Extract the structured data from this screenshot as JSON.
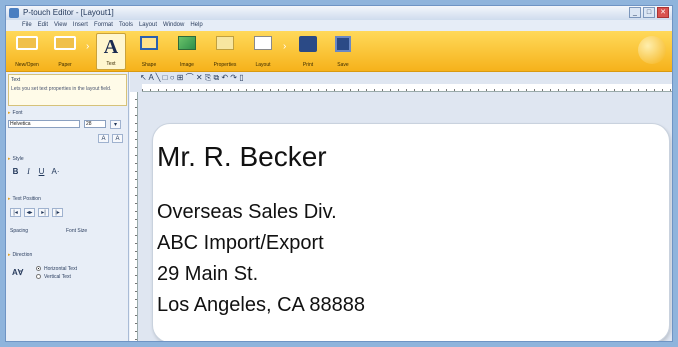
{
  "window": {
    "title": "P-touch Editor - [Layout1]",
    "controls": [
      "_",
      "□",
      "✕"
    ]
  },
  "menu": [
    "File",
    "Edit",
    "View",
    "Insert",
    "Format",
    "Tools",
    "Layout",
    "Window",
    "Help"
  ],
  "ribbon": {
    "buttons": [
      {
        "label": "New/Open",
        "icon": "frame-icon"
      },
      {
        "label": "Paper",
        "icon": "frame-icon"
      },
      {
        "label": "Text",
        "icon": "text-a-icon"
      },
      {
        "label": "Shape",
        "icon": "shape-icon"
      },
      {
        "label": "Image",
        "icon": "image-icon"
      },
      {
        "label": "Properties",
        "icon": "pen-icon"
      },
      {
        "label": "Layout",
        "icon": "layout-icon"
      },
      {
        "label": "Print",
        "icon": "print-icon"
      },
      {
        "label": "Save",
        "icon": "save-icon"
      }
    ]
  },
  "sidebar": {
    "tip_title": "Text",
    "tip_text": "Lets you set text properties in the layout field.",
    "font_section": "Font",
    "font_name": "Helvetica",
    "font_size": "28",
    "grow_label": "A",
    "shrink_label": "A",
    "style_section": "Style",
    "bold": "B",
    "italic": "I",
    "underline": "U",
    "text_pos_section": "Text Position",
    "align_labels": [
      "|◂",
      "◂▸",
      "▸|",
      "|▸"
    ],
    "spacing_left": "Spacing",
    "spacing_right": "Font Size",
    "direction_section": "Direction",
    "direction_icon": "A∀",
    "horizontal": "Horizontal Text",
    "vertical": "Vertical Text"
  },
  "draw_tools": "↖ A ╲ □ ○ ⊞ ⌒ ✕ ⎘ ⧉ ↶ ↷ ▯",
  "label": {
    "name": "Mr. R. Becker",
    "lines": [
      "Overseas Sales Div.",
      "ABC Import/Export",
      "29 Main St.",
      "Los Angeles, CA 88888"
    ]
  }
}
